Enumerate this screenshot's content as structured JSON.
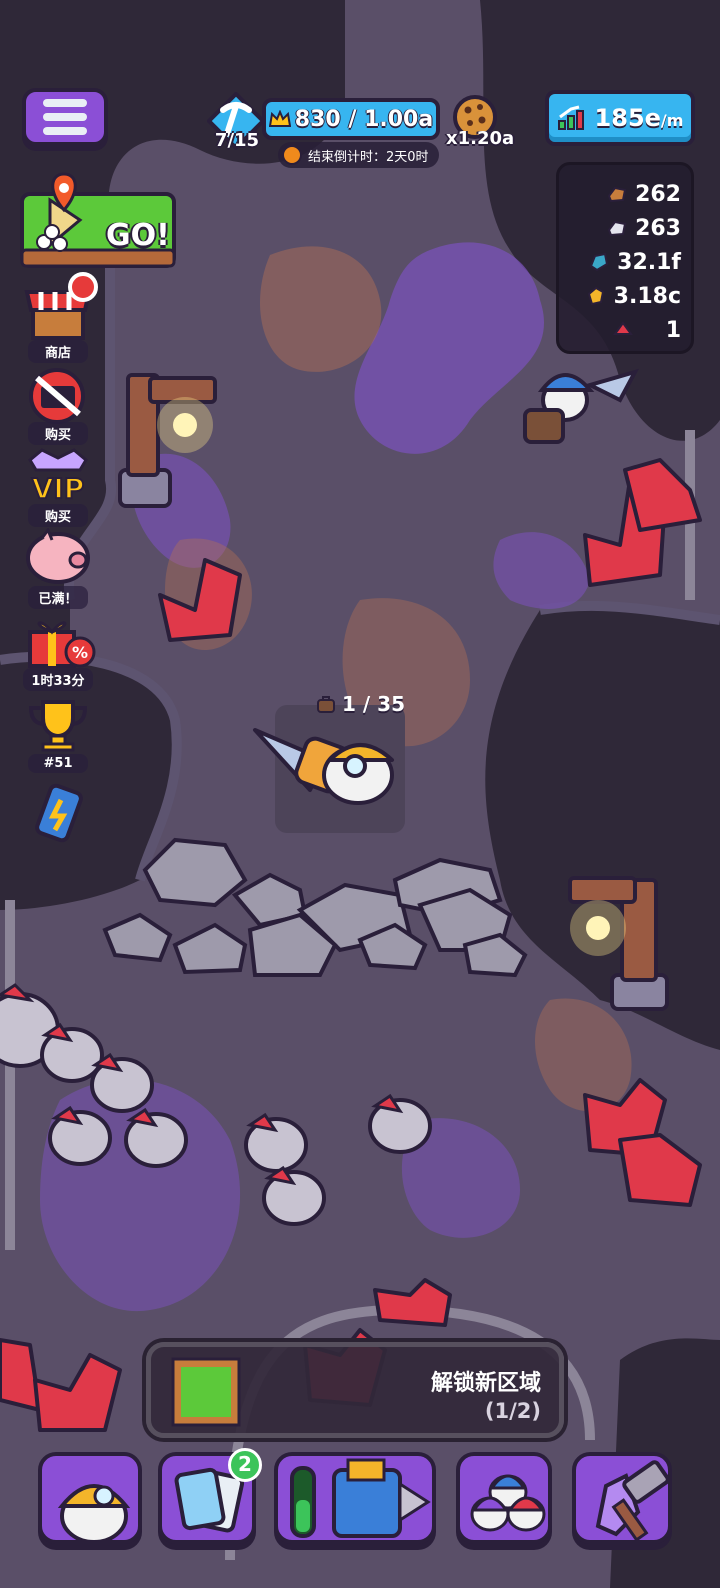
{
  "hud": {
    "pickaxe_count": "7/15",
    "crown_value": "830 / 1.00a",
    "countdown": "结束倒计时：2天0时",
    "cookie_multiplier": "x1.20a",
    "rate_value": "185e",
    "rate_unit": "/m"
  },
  "resources": [
    {
      "icon": "bronze-ore-icon",
      "value": "262"
    },
    {
      "icon": "silver-ore-icon",
      "value": "263"
    },
    {
      "icon": "blue-crystal-icon",
      "value": "32.1f"
    },
    {
      "icon": "gold-ore-icon",
      "value": "3.18c"
    },
    {
      "icon": "red-gem-icon",
      "value": "1"
    }
  ],
  "sidebar": {
    "go_label": "GO!",
    "items": [
      {
        "label": "商店",
        "icon": "shop-icon"
      },
      {
        "label": "购买",
        "icon": "no-ads-icon"
      },
      {
        "label": "购买",
        "icon": "vip-icon"
      },
      {
        "label": "已满！",
        "icon": "piggy-bank-icon"
      },
      {
        "label": "1时33分",
        "icon": "gift-sale-icon"
      },
      {
        "label": "#51",
        "icon": "trophy-icon"
      },
      {
        "label": "",
        "icon": "energy-drink-icon"
      }
    ]
  },
  "drill": {
    "capacity": "1 / 35"
  },
  "unlock": {
    "title": "解锁新区域",
    "progress": "(1/2)"
  },
  "bottom_nav": {
    "cards_badge": "2"
  },
  "colors": {
    "accent_purple": "#8b4fd6",
    "accent_blue": "#37b5f0",
    "crystal_red": "#e0394a",
    "outline": "#2a1f3a"
  }
}
